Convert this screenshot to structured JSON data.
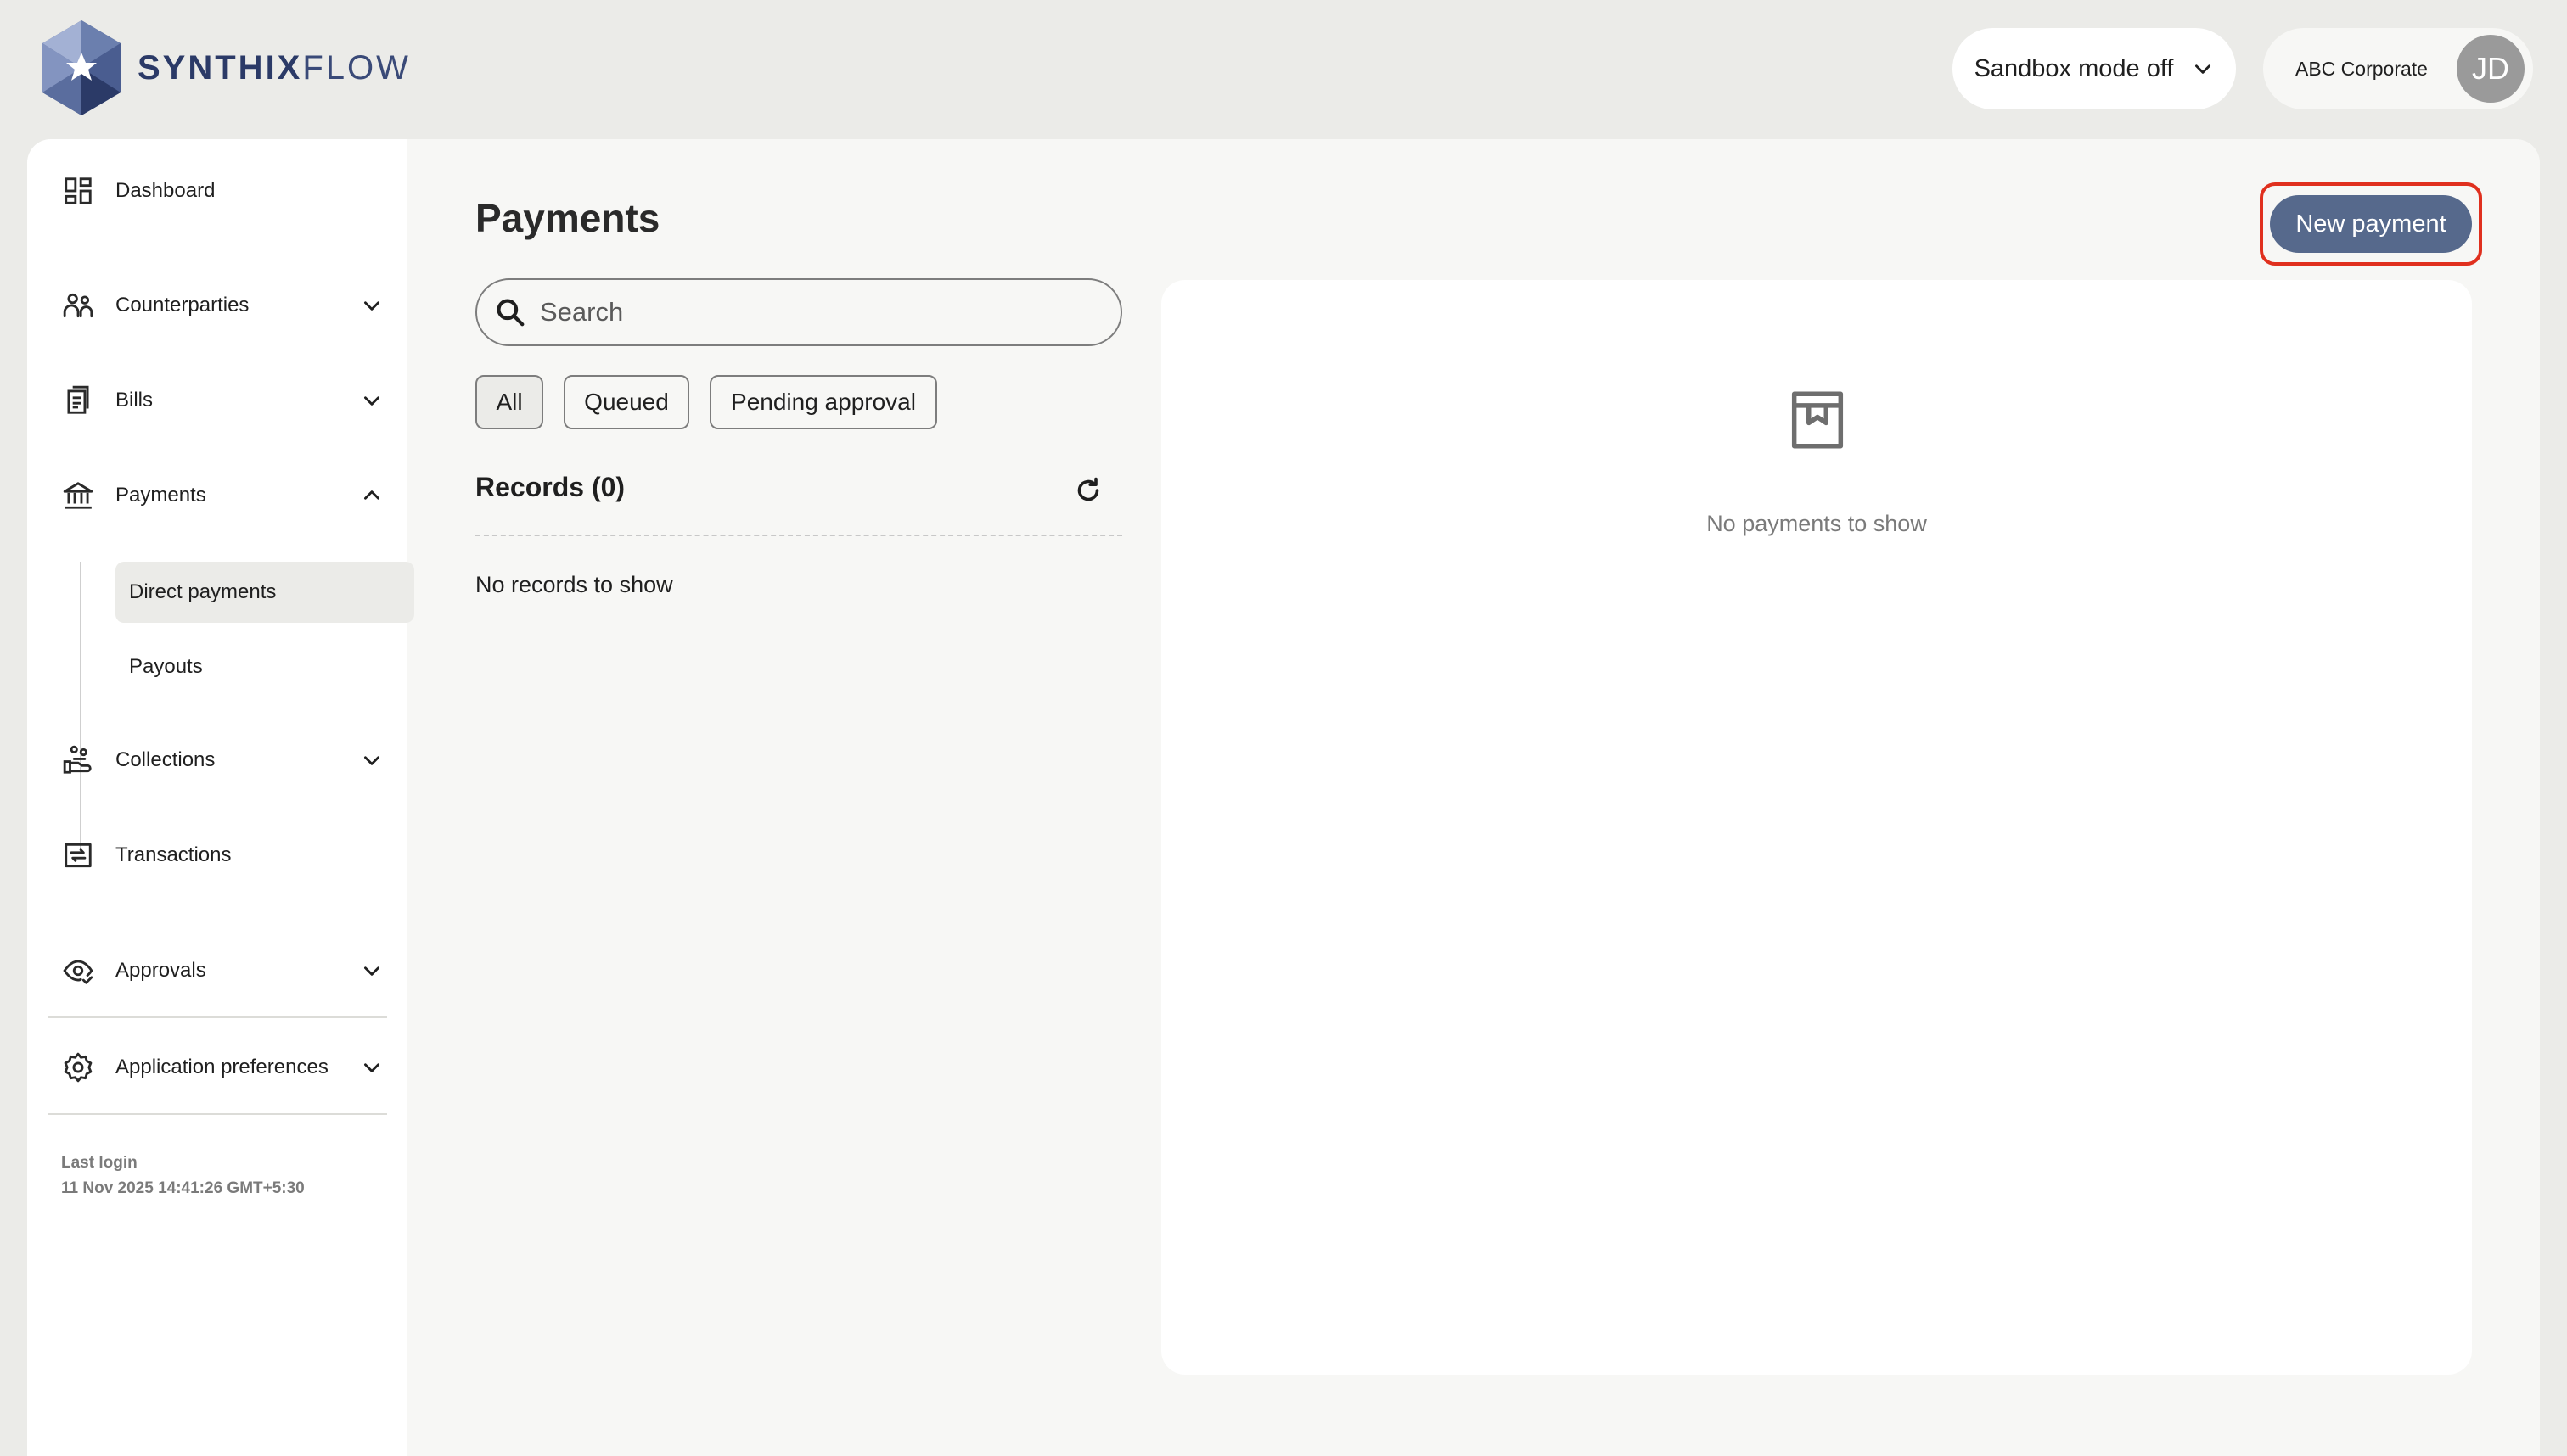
{
  "brand": {
    "name_bold": "SYNTHIX",
    "name_light": "FLOW"
  },
  "header": {
    "sandbox_label": "Sandbox mode off",
    "account_name": "ABC Corporate",
    "avatar_initials": "JD"
  },
  "sidebar": {
    "items": {
      "dashboard": "Dashboard",
      "counterparties": "Counterparties",
      "bills": "Bills",
      "payments": "Payments",
      "collections": "Collections",
      "transactions": "Transactions",
      "approvals": "Approvals",
      "preferences": "Application preferences"
    },
    "payments_sub": {
      "direct": "Direct payments",
      "payouts": "Payouts"
    },
    "last_login_label": "Last login",
    "last_login_value": "11 Nov 2025 14:41:26 GMT+5:30"
  },
  "main": {
    "title": "Payments",
    "new_payment_label": "New payment",
    "search_placeholder": "Search",
    "filters": {
      "all": "All",
      "queued": "Queued",
      "pending": "Pending approval"
    },
    "records_title": "Records (0)",
    "no_records": "No records to show",
    "empty_state": "No payments to show"
  },
  "colors": {
    "accent": "#56698c",
    "highlight": "#e0301e",
    "brand": "#2b3a67"
  }
}
